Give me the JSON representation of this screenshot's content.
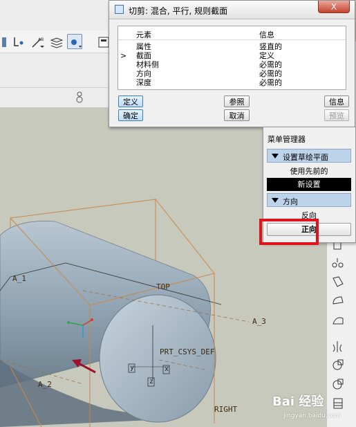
{
  "dialog": {
    "title": "切剪: 混合, 平行, 规则截面",
    "close_label": "X",
    "table": {
      "col_element": "元素",
      "col_info": "信息",
      "rows": [
        {
          "marker": "",
          "element": "属性",
          "info": "竖直的"
        },
        {
          "marker": ">",
          "element": "截面",
          "info": "定义"
        },
        {
          "marker": "",
          "element": "材料侧",
          "info": "必需的"
        },
        {
          "marker": "",
          "element": "方向",
          "info": "必需的"
        },
        {
          "marker": "",
          "element": "深度",
          "info": "必需的"
        }
      ]
    },
    "buttons": {
      "define": "定义",
      "reference": "参照",
      "info": "信息",
      "ok": "确定",
      "cancel": "取消",
      "preview": "预览"
    }
  },
  "menu_manager": {
    "title": "菜单管理器",
    "section_setup": "设置草绘平面",
    "item_use_previous": "使用先前的",
    "item_new_setup": "新设置",
    "section_direction": "方向",
    "item_reverse": "反向",
    "item_forward": "正向"
  },
  "viewport": {
    "labels": {
      "a1": "A_1",
      "a2": "A_2",
      "a3": "A_3",
      "top": "TOP",
      "right": "RIGHT",
      "csys": "PRT_CSYS_DEF",
      "y": "y",
      "x": "x",
      "z": "z"
    }
  },
  "watermark": {
    "text": "Bai 经验",
    "url": "jingyan.baidu.com"
  },
  "colors": {
    "datum_plane": "#c9884a",
    "model_fill": "#93a6b6",
    "highlight": "#e0121b",
    "section_header": "#bcd3ea"
  }
}
